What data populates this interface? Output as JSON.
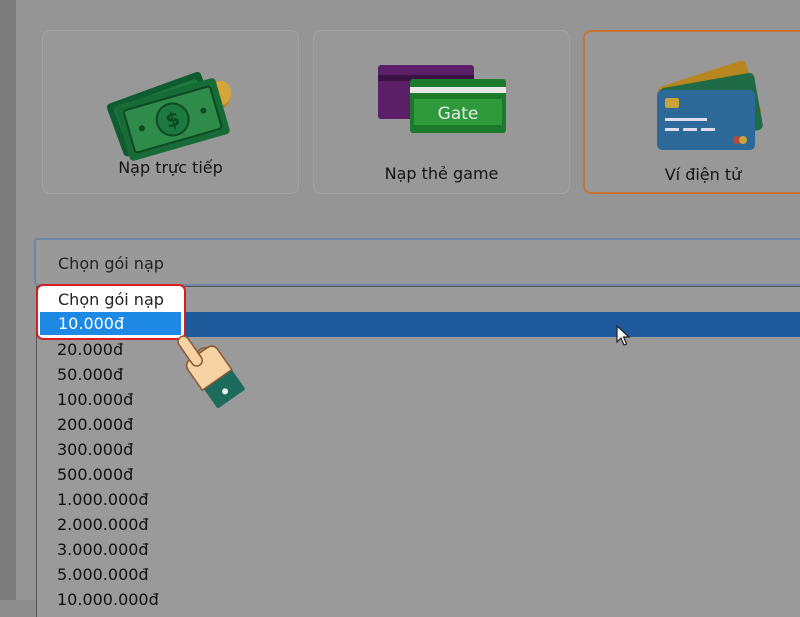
{
  "payment_methods": [
    {
      "label": "Nạp trực tiếp",
      "icon": "cash-icon"
    },
    {
      "label": "Nạp thẻ game",
      "icon": "gate-card-icon",
      "card_text": "Gate"
    },
    {
      "label": "Ví điện tử",
      "icon": "credit-card-icon"
    }
  ],
  "select": {
    "value": "Chọn gói nạp",
    "options": [
      "Chọn gói nạp",
      "10.000đ",
      "20.000đ",
      "50.000đ",
      "100.000đ",
      "200.000đ",
      "300.000đ",
      "500.000đ",
      "1.000.000đ",
      "2.000.000đ",
      "3.000.000đ",
      "5.000.000đ",
      "10.000.000đ"
    ],
    "selected_index": 1
  },
  "colors": {
    "active_border": "#c9742c",
    "highlight_border": "#d51f26",
    "selected_option": "#1e88e5"
  }
}
